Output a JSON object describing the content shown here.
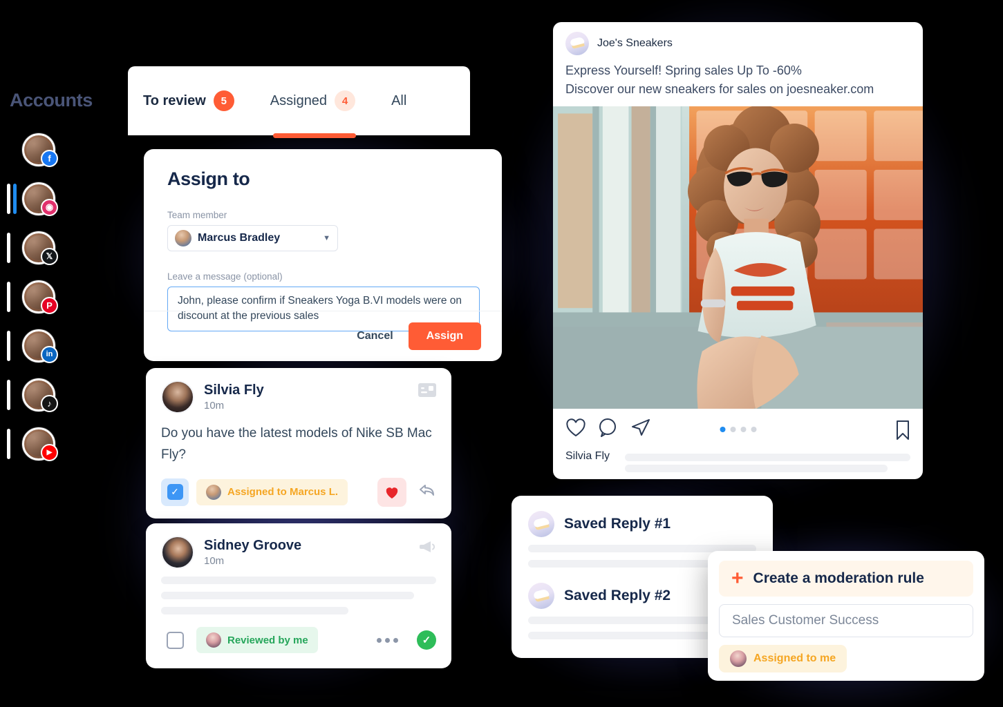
{
  "sidebar": {
    "title": "Accounts",
    "accounts": [
      {
        "platform": "facebook",
        "icon": "facebook-icon",
        "glyph": "f",
        "color": "#1877F2",
        "active": false,
        "indicator": false
      },
      {
        "platform": "instagram",
        "icon": "instagram-icon",
        "glyph": "◉",
        "color": "#E1306C",
        "active": true,
        "indicator": true
      },
      {
        "platform": "x",
        "icon": "x-icon",
        "glyph": "𝕏",
        "color": "#14171A",
        "active": false,
        "indicator": true
      },
      {
        "platform": "pinterest",
        "icon": "pinterest-icon",
        "glyph": "P",
        "color": "#E60023",
        "active": false,
        "indicator": true
      },
      {
        "platform": "linkedin",
        "icon": "linkedin-icon",
        "glyph": "in",
        "color": "#0A66C2",
        "active": false,
        "indicator": true
      },
      {
        "platform": "tiktok",
        "icon": "tiktok-icon",
        "glyph": "♪",
        "color": "#151515",
        "active": false,
        "indicator": true
      },
      {
        "platform": "youtube",
        "icon": "youtube-icon",
        "glyph": "▶",
        "color": "#FF0000",
        "active": false,
        "indicator": true
      }
    ]
  },
  "tabs": [
    {
      "label": "To review",
      "badge": "5",
      "active": true
    },
    {
      "label": "Assigned",
      "badge": "4",
      "active": false
    },
    {
      "label": "All",
      "badge": "",
      "active": false
    }
  ],
  "assign_modal": {
    "title": "Assign to",
    "team_member_label": "Team member",
    "team_member_value": "Marcus Bradley",
    "message_label": "Leave a message (optional)",
    "message_value": "John, please confirm if Sneakers Yoga B.VI models were on discount at the previous sales",
    "cancel_label": "Cancel",
    "assign_label": "Assign"
  },
  "comments": [
    {
      "name": "Silvia Fly",
      "time": "10m",
      "type_icon": "comment-icon",
      "text": "Do you have the latest models of Nike SB Mac Fly?",
      "checked": true,
      "status_label": "Assigned to Marcus L.",
      "status_type": "assigned",
      "liked": true
    },
    {
      "name": "Sidney Groove",
      "time": "10m",
      "type_icon": "megaphone-icon",
      "text": "",
      "checked": false,
      "status_label": "Reviewed by me",
      "status_type": "reviewed",
      "liked": false
    }
  ],
  "post": {
    "account_name": "Joe's Sneakers",
    "caption_line1": "Express Yourself! Spring sales Up To -60%",
    "caption_line2": "Discover our new sneakers for sales on joesneaker.com",
    "actions": [
      "like-icon",
      "comment-icon",
      "share-icon",
      "bookmark-icon"
    ],
    "carousel_dots": 4,
    "carousel_active_index": 0,
    "commenter": "Silvia Fly"
  },
  "saved_replies": [
    {
      "title": "Saved Reply #1"
    },
    {
      "title": "Saved Reply #2"
    }
  ],
  "moderation_rule": {
    "title": "Create a moderation rule",
    "add_icon": "plus-icon",
    "input_value": "Sales Customer Success",
    "assignee_label": "Assigned to me"
  },
  "colors": {
    "accent_orange": "#ff5c35",
    "navy": "#16284a",
    "blue": "#1f8cf0",
    "green": "#2ebd59",
    "amber": "#f5a623",
    "background": "#000000"
  }
}
